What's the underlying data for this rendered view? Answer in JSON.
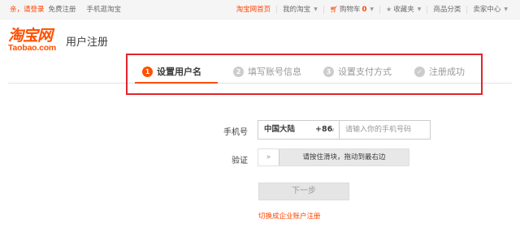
{
  "topbar": {
    "greeting": "亲，请登录",
    "free_register": "免费注册",
    "mobile": "手机逛淘宝",
    "home": "淘宝网首页",
    "my_taobao": "我的淘宝",
    "cart_label": "购物车",
    "cart_count": "0",
    "favorites": "收藏夹",
    "categories": "商品分类",
    "seller_center": "卖家中心"
  },
  "header": {
    "logo_cn": "淘宝网",
    "logo_en": "Taobao.com",
    "title": "用户注册"
  },
  "steps": [
    {
      "num": "1",
      "label": "设置用户名",
      "state": "active"
    },
    {
      "num": "2",
      "label": "填写账号信息",
      "state": "todo"
    },
    {
      "num": "3",
      "label": "设置支付方式",
      "state": "todo"
    },
    {
      "num": "✓",
      "label": "注册成功",
      "state": "todo"
    }
  ],
  "form": {
    "phone_label": "手机号",
    "country": "中国大陆",
    "country_code": "+86",
    "phone_placeholder": "请输入你的手机号码",
    "phone_value": "",
    "verify_label": "验证",
    "slider_hint": "请按住滑块，拖动到最右边",
    "next_button": "下一步",
    "business_link": "切换成企业账户注册"
  },
  "colors": {
    "accent": "#ff5000",
    "highlight_border": "#e3242b"
  }
}
